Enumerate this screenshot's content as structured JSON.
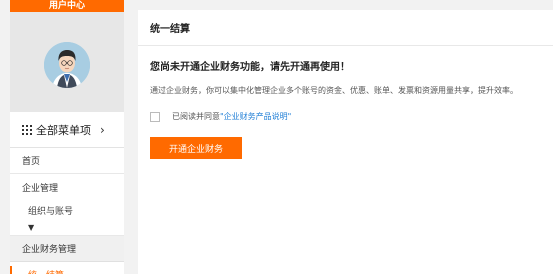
{
  "sidebar": {
    "banner_label": "用户中心",
    "menu_all_label": "全部菜单项",
    "menu_all_chevron": "›",
    "items": [
      {
        "label": "首页"
      },
      {
        "label": "企业管理"
      },
      {
        "label": "组织与账号"
      },
      {
        "label": "企业财务管理"
      },
      {
        "label": "统一结算"
      }
    ],
    "caret": "▼"
  },
  "main": {
    "title": "统一结算",
    "notice_heading": "您尚未开通企业财务功能，请先开通再使用！",
    "notice_desc": "通过企业财务，你可以集中化管理企业多个账号的资金、优惠、账单、发票和资源用量共享，提升效率。",
    "agree_prefix": "已阅读并同意",
    "agree_link": "\"企业财务产品说明\"",
    "open_button_label": "开通企业财务"
  },
  "colors": {
    "accent": "#ff6a00",
    "link": "#1f7ed6",
    "avatar_bg": "#a8cde2"
  },
  "icons": {
    "grid": "grid-icon",
    "avatar": "user-avatar-icon",
    "chevron": "chevron-right-icon",
    "caret": "caret-down-icon"
  }
}
